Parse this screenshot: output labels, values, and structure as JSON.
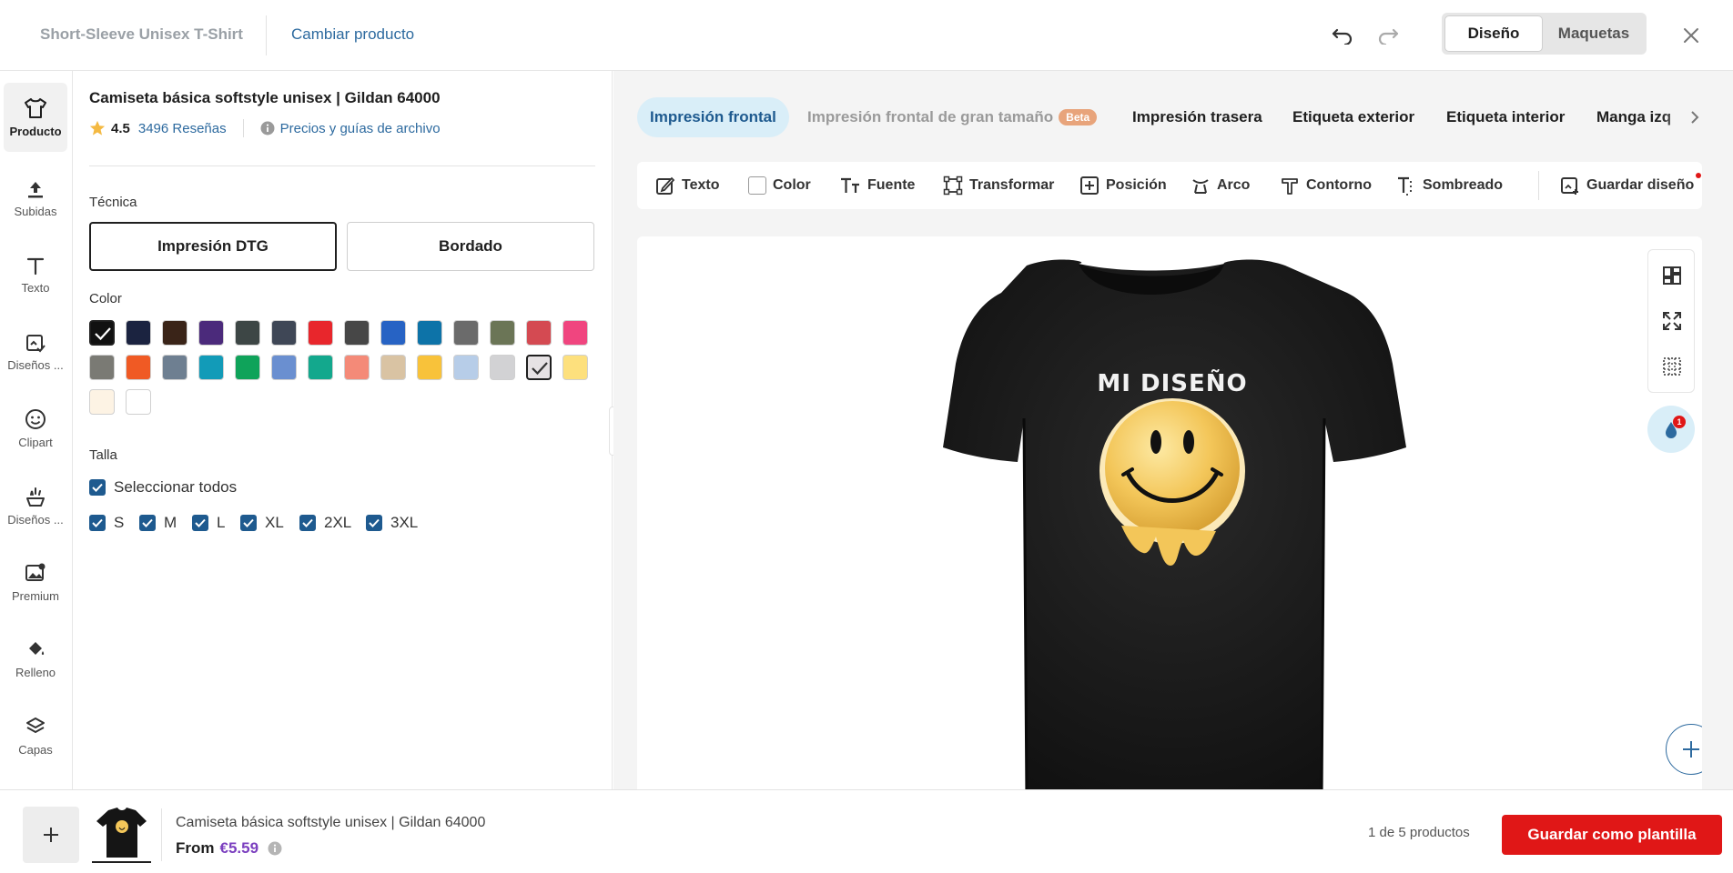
{
  "topbar": {
    "product_name": "Short-Sleeve Unisex T-Shirt",
    "change_product": "Cambiar producto",
    "mode_design": "Diseño",
    "mode_mockups": "Maquetas"
  },
  "rail": {
    "items": [
      {
        "label": "Producto",
        "icon": "tshirt-icon"
      },
      {
        "label": "Subidas",
        "icon": "upload-icon"
      },
      {
        "label": "Texto",
        "icon": "text-icon"
      },
      {
        "label": "Diseños ...",
        "icon": "designs-icon"
      },
      {
        "label": "Clipart",
        "icon": "smiley-icon"
      },
      {
        "label": "Diseños ...",
        "icon": "sparkle-designs-icon"
      },
      {
        "label": "Premium",
        "icon": "premium-image-icon"
      },
      {
        "label": "Relleno",
        "icon": "paint-bucket-icon"
      },
      {
        "label": "Capas",
        "icon": "layers-icon"
      }
    ]
  },
  "product": {
    "title": "Camiseta básica softstyle unisex | Gildan 64000",
    "rating": "4.5",
    "reviews": "3496 Reseñas",
    "guides": "Precios y guías de archivo",
    "technique_label": "Técnica",
    "technique_options": [
      "Impresión DTG",
      "Bordado"
    ],
    "technique_selected": "Impresión DTG",
    "color_label": "Color",
    "colors": [
      "#111111",
      "#1b2340",
      "#3a2418",
      "#4b2a7b",
      "#3d4645",
      "#3f4756",
      "#e8262c",
      "#474747",
      "#2763c4",
      "#0d73a8",
      "#6b6b6b",
      "#6b7556",
      "#d44a52",
      "#f0457f",
      "#7a7a74",
      "#f05a24",
      "#6e7f91",
      "#129bb8",
      "#0fa35a",
      "#6a8fd0",
      "#13a88d",
      "#f48a78",
      "#d9c3a3",
      "#f8c23a",
      "#b7cde8",
      "#d2d2d4",
      "#e6e2e4",
      "#fde07d",
      "#fdf3e4",
      "#ffffff"
    ],
    "size_label": "Talla",
    "select_all": "Seleccionar todos",
    "sizes": [
      "S",
      "M",
      "L",
      "XL",
      "2XL",
      "3XL"
    ]
  },
  "placements": {
    "tabs": [
      "Impresión frontal",
      "Impresión frontal de gran tamaño",
      "Impresión trasera",
      "Etiqueta exterior",
      "Etiqueta interior",
      "Manga izq"
    ],
    "beta_badge": "Beta"
  },
  "toolbar": {
    "tools": [
      "Texto",
      "Color",
      "Fuente",
      "Transformar",
      "Posición",
      "Arco",
      "Contorno",
      "Sombreado",
      "Guardar diseño"
    ]
  },
  "design": {
    "text": "MI DISEÑO",
    "shirt_color": "#1b1b1b",
    "badge_count": "1"
  },
  "bottom": {
    "name": "Camiseta básica softstyle unisex | Gildan 64000",
    "from_label": "From",
    "price": "€5.59",
    "count": "1 de 5 productos",
    "save_template": "Guardar como plantilla"
  },
  "colors": {
    "accent_blue": "#1e5a8f",
    "link_blue": "#2d6a9f",
    "primary_red": "#e01717",
    "price_purple": "#7b3fbf"
  }
}
